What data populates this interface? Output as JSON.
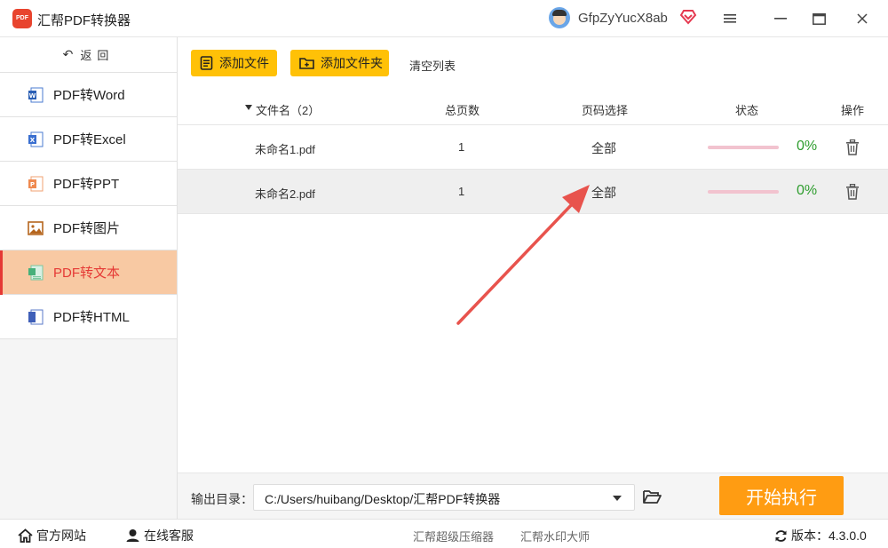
{
  "app": {
    "title": "汇帮PDF转换器",
    "logo_text": "PDF",
    "username": "GfpZyYucX8ab"
  },
  "colors": {
    "accent_yellow": "#ffc107",
    "start_orange": "#ff9c12",
    "active_nav_bg": "#f8c9a3",
    "active_nav_text": "#e53935",
    "progress_text": "#2e9d2e",
    "annotation_arrow": "#e8534d"
  },
  "sidebar": {
    "back_label": "返回",
    "items": [
      {
        "label": "PDF转Word",
        "icon": "word-doc-icon",
        "active": false
      },
      {
        "label": "PDF转Excel",
        "icon": "excel-doc-icon",
        "active": false
      },
      {
        "label": "PDF转PPT",
        "icon": "ppt-doc-icon",
        "active": false
      },
      {
        "label": "PDF转图片",
        "icon": "image-icon",
        "active": false
      },
      {
        "label": "PDF转文本",
        "icon": "text-doc-icon",
        "active": true
      },
      {
        "label": "PDF转HTML",
        "icon": "html-doc-icon",
        "active": false
      }
    ]
  },
  "toolbar": {
    "add_file": "添加文件",
    "add_folder": "添加文件夹",
    "clear_list": "清空列表"
  },
  "table": {
    "headers": {
      "filename": "文件名（2）",
      "total_pages": "总页数",
      "page_select": "页码选择",
      "status": "状态",
      "action": "操作"
    },
    "rows": [
      {
        "filename": "未命名1.pdf",
        "pages": "1",
        "page_select": "全部",
        "progress": "0%",
        "selected": false
      },
      {
        "filename": "未命名2.pdf",
        "pages": "1",
        "page_select": "全部",
        "progress": "0%",
        "selected": true
      }
    ]
  },
  "output": {
    "label": "输出目录：",
    "path": "C:/Users/huibang/Desktop/汇帮PDF转换器",
    "start_button": "开始执行"
  },
  "footer": {
    "website": "官方网站",
    "support": "在线客服",
    "link1": "汇帮超级压缩器",
    "link2": "汇帮水印大师",
    "version": "版本：4.3.0.0"
  }
}
